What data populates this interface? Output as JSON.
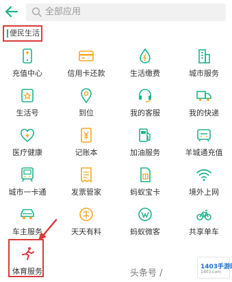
{
  "search": {
    "placeholder": "全部应用"
  },
  "category": {
    "label": "便民生活"
  },
  "grid": [
    {
      "label": "充值中心",
      "icon": "phone-topup-icon"
    },
    {
      "label": "信用卡还款",
      "icon": "credit-card-icon"
    },
    {
      "label": "生活缴费",
      "icon": "utility-bill-icon"
    },
    {
      "label": "城市服务",
      "icon": "city-building-icon"
    },
    {
      "label": "生活号",
      "icon": "life-account-icon"
    },
    {
      "label": "到位",
      "icon": "location-pin-icon"
    },
    {
      "label": "我的客服",
      "icon": "customer-service-icon"
    },
    {
      "label": "我的快递",
      "icon": "delivery-truck-icon"
    },
    {
      "label": "医疗健康",
      "icon": "medical-stethoscope-icon"
    },
    {
      "label": "记账本",
      "icon": "account-book-icon"
    },
    {
      "label": "加油服务",
      "icon": "fuel-pump-icon"
    },
    {
      "label": "羊城通充值",
      "icon": "transit-card-icon"
    },
    {
      "label": "城市一卡通",
      "icon": "city-card-icon"
    },
    {
      "label": "发票管家",
      "icon": "invoice-icon"
    },
    {
      "label": "蚂蚁宝卡",
      "icon": "sim-card-icon"
    },
    {
      "label": "境外上网",
      "icon": "wifi-icon"
    },
    {
      "label": "车主服务",
      "icon": "car-icon"
    },
    {
      "label": "天天有料",
      "icon": "daily-news-icon"
    },
    {
      "label": "蚂蚁微客",
      "icon": "ant-weike-icon"
    },
    {
      "label": "共享单车",
      "icon": "bicycle-icon"
    },
    {
      "label": "体育服务",
      "icon": "sports-runner-icon"
    }
  ],
  "footer": {
    "text": "头条号 /"
  },
  "watermark": {
    "line1": "1403手游网",
    "line2": "1403.com"
  },
  "colors": {
    "accent": "#1db38b",
    "highlight": "#d93a3a"
  }
}
